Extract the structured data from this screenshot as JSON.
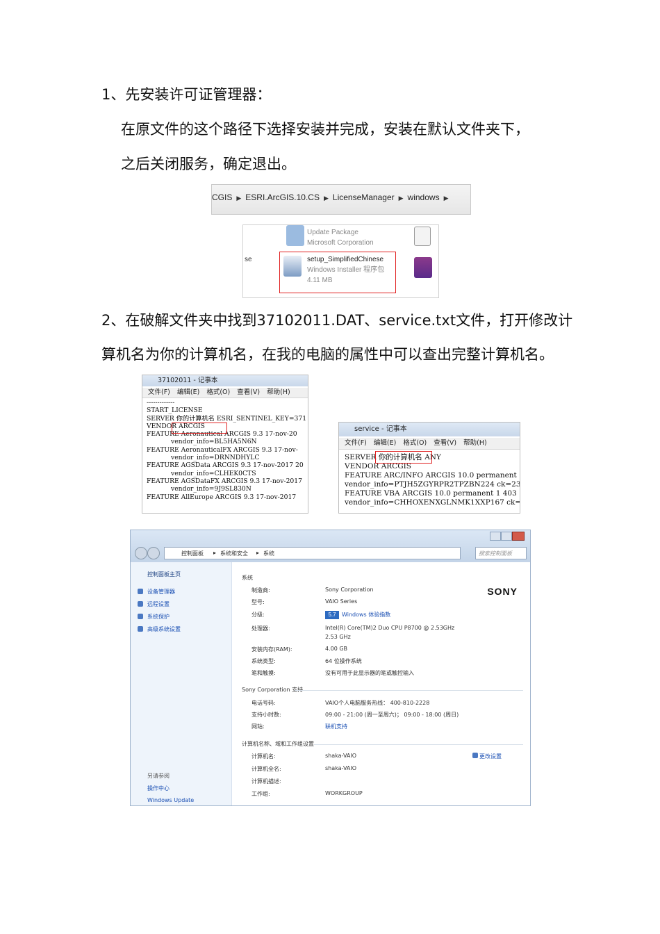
{
  "step1": {
    "heading": "1、先安装许可证管理器：",
    "line1": "在原文件的这个路径下选择安装并完成，安装在默认文件夹下，",
    "line2": "之后关闭服务，确定退出。"
  },
  "breadcrumb": {
    "items": [
      "CGIS",
      "ESRI.ArcGIS.10.CS",
      "LicenseManager",
      "windows"
    ]
  },
  "installer_files": {
    "update_name": "Update Package",
    "update_publisher": "Microsoft Corporation",
    "edge_text": "se",
    "setup_name": "setup_SimplifiedChinese",
    "setup_type": "Windows Installer 程序包",
    "setup_size": "4.11 MB"
  },
  "step2": {
    "line1": "2、在破解文件夹中找到37102011.DAT、service.txt文件，打开修改计",
    "line2": "算机名为你的计算机名，在我的电脑的属性中可以查出完整计算机名。"
  },
  "notepad1": {
    "title": "37102011 - 记事本",
    "menu": [
      "文件(F)",
      "编辑(E)",
      "格式(O)",
      "查看(V)",
      "帮助(H)"
    ],
    "lines": [
      "-------------",
      "START_LICENSE",
      "",
      "SERVER 你的计算机名 ESRI_SENTINEL_KEY=371",
      "VENDOR ARCGIS",
      "FEATURE Aeronautical ARCGIS 9.3 17-nov-20",
      "            vendor_info=BL5HA5N6N",
      "FEATURE AeronauticalFX ARCGIS 9.3 17-nov-",
      "            vendor_info=DRNNDHYLC",
      "FEATURE AGSData ARCGIS 9.3 17-nov-2017 20",
      "            vendor_info=CLHEK0CTS",
      "FEATURE AGSDataFX ARCGIS 9.3 17-nov-2017",
      "            vendor_info=9J9SL830N",
      "FEATURE AllEurope ARCGIS 9.3 17-nov-2017"
    ],
    "highlight": "你的计算机名"
  },
  "notepad2": {
    "title": "service - 记事本",
    "menu": [
      "文件(F)",
      "编辑(E)",
      "格式(O)",
      "查看(V)",
      "帮助(H)"
    ],
    "lines": [
      "SERVER 你的计算机名 ANY",
      "VENDOR ARCGIS",
      "FEATURE ARC/INFO ARCGIS 10.0 permanent",
      "vendor_info=PTJH5ZGYRPR2TPZBN224 ck=235",
      "FEATURE VBA ARCGIS 10.0 permanent 1 403",
      "vendor_info=CHHOXENXGLNMK1XXP167 ck=38"
    ],
    "highlight": "你的计算机名"
  },
  "system_window": {
    "path": [
      "控制面板",
      "系统和安全",
      "系统"
    ],
    "search_placeholder": "搜索控制面板",
    "sidebar_home": "控制面板主页",
    "sidebar_links": [
      "设备管理器",
      "远程设置",
      "系统保护",
      "高级系统设置"
    ],
    "see_also_title": "另请参阅",
    "see_also_links": [
      "操作中心",
      "Windows Update"
    ],
    "brand": "SONY",
    "system_section": "系统",
    "system_rows": [
      {
        "label": "制造商:",
        "value": "Sony Corporation"
      },
      {
        "label": "型号:",
        "value": "VAIO Series"
      },
      {
        "label": "分级:",
        "value": "Windows 体验指数"
      },
      {
        "label": "处理器:",
        "value": "Intel(R) Core(TM)2 Duo CPU     P8700  @ 2.53GHz"
      },
      {
        "label": "",
        "value": "2.53 GHz"
      },
      {
        "label": "安装内存(RAM):",
        "value": "4.00 GB"
      },
      {
        "label": "系统类型:",
        "value": "64 位操作系统"
      },
      {
        "label": "笔和触摸:",
        "value": "没有可用于此显示器的笔或触控输入"
      }
    ],
    "rating_badge": "5.7",
    "support_section": "Sony Corporation 支持",
    "support_rows": [
      {
        "label": "电话号码:",
        "value": "VAIO个人电脑服务热线： 400-810-2228"
      },
      {
        "label": "支持小时数:",
        "value": "09:00 - 21:00 (周一至周六)；  09:00 - 18:00 (周日)"
      },
      {
        "label": "网站:",
        "value": "联机支持"
      }
    ],
    "computer_section": "计算机名称、域和工作组设置",
    "computer_rows": [
      {
        "label": "计算机名:",
        "value": "shaka-VAIO"
      },
      {
        "label": "计算机全名:",
        "value": "shaka-VAIO"
      },
      {
        "label": "计算机描述:",
        "value": ""
      },
      {
        "label": "工作组:",
        "value": "WORKGROUP"
      }
    ],
    "change_settings": "更改设置"
  }
}
